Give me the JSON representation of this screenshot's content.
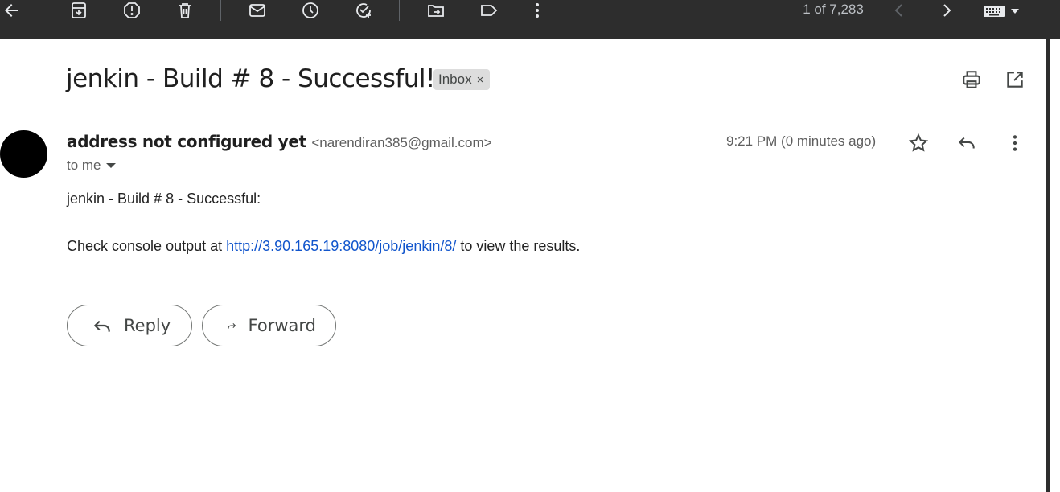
{
  "toolbar": {
    "icons": [
      "back-arrow-icon",
      "archive-icon",
      "report-spam-icon",
      "delete-icon",
      "mark-unread-icon",
      "snooze-icon",
      "add-task-icon",
      "move-to-icon",
      "label-icon",
      "more-vert-icon"
    ],
    "pager_text": "1 of 7,283"
  },
  "email": {
    "subject": "jenkin - Build # 8 - Successful!",
    "label": "Inbox",
    "label_remove": "×",
    "sender_name": "address not configured yet",
    "sender_email": "<narendiran385@gmail.com>",
    "recipient": "to me",
    "timestamp": "9:21 PM (0 minutes ago)",
    "body_line1": "jenkin - Build # 8 - Successful:",
    "body_line2_pre": "Check console output at ",
    "body_link": "http://3.90.165.19:8080/job/jenkin/8/",
    "body_line2_post": " to view the results."
  },
  "actions": {
    "reply_label": "Reply",
    "forward_label": "Forward"
  },
  "colors": {
    "toolbar_bg": "#2d2d2d",
    "link": "#1155cc",
    "label_chip_bg": "#dddddd",
    "avatar": "#000000"
  }
}
